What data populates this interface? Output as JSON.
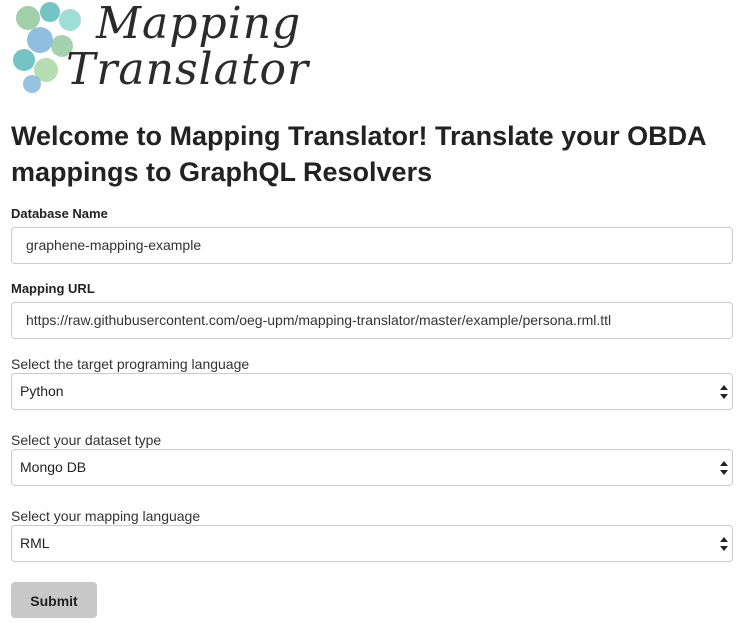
{
  "logo": {
    "line1": "Mapping",
    "line2": "Translator"
  },
  "page_title": "Welcome to Mapping Translator! Translate your OBDA mappings to GraphQL Resolvers",
  "form": {
    "database_name": {
      "label": "Database Name",
      "value": "graphene-mapping-example"
    },
    "mapping_url": {
      "label": "Mapping URL",
      "value": "https://raw.githubusercontent.com/oeg-upm/mapping-translator/master/example/persona.rml.ttl"
    },
    "target_language": {
      "label": "Select the target programing language",
      "selected": "Python"
    },
    "dataset_type": {
      "label": "Select your dataset type",
      "selected": "Mongo DB"
    },
    "mapping_language": {
      "label": "Select your mapping language",
      "selected": "RML"
    },
    "submit_label": "Submit"
  },
  "colors": {
    "logo_teal": "#4fb7b3",
    "logo_green": "#8fc79a",
    "logo_blue": "#6aa9d6",
    "button_bg": "#c8c8c8",
    "input_border": "#cccccc"
  }
}
